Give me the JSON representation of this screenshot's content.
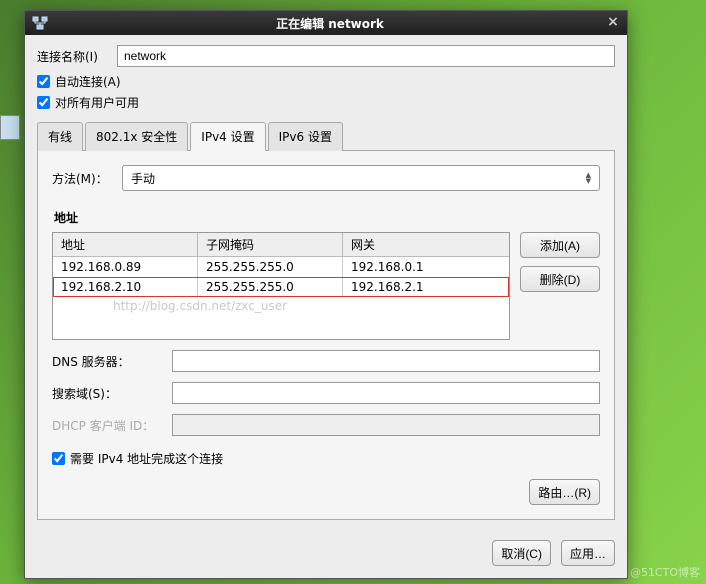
{
  "titlebar": {
    "title": "正在编辑  network"
  },
  "conn_name": {
    "label": "连接名称(I)",
    "value": "network"
  },
  "checks": {
    "auto_connect": "自动连接(A)",
    "all_users": "对所有用户可用"
  },
  "tabs": {
    "wired": "有线",
    "security": "802.1x 安全性",
    "ipv4": "IPv4 设置",
    "ipv6": "IPv6 设置"
  },
  "method": {
    "label": "方法(M)：",
    "value": "手动"
  },
  "addresses": {
    "section": "地址",
    "headers": {
      "addr": "地址",
      "mask": "子网掩码",
      "gw": "网关"
    },
    "rows": [
      {
        "addr": "192.168.0.89",
        "mask": "255.255.255.0",
        "gw": "192.168.0.1",
        "hl": false
      },
      {
        "addr": "192.168.2.10",
        "mask": "255.255.255.0",
        "gw": "192.168.2.1",
        "hl": true
      }
    ],
    "watermark": "http://blog.csdn.net/zxc_user",
    "buttons": {
      "add": "添加(A)",
      "del": "删除(D)"
    }
  },
  "fields": {
    "dns": "DNS 服务器：",
    "search": "搜索域(S)：",
    "dhcp": "DHCP 客户端 ID："
  },
  "require_ipv4": "需要 IPv4 地址完成这个连接",
  "routes": "路由…(R)",
  "footer": {
    "cancel": "取消(C)",
    "apply": "应用…"
  },
  "attrib": "@51CTO博客"
}
